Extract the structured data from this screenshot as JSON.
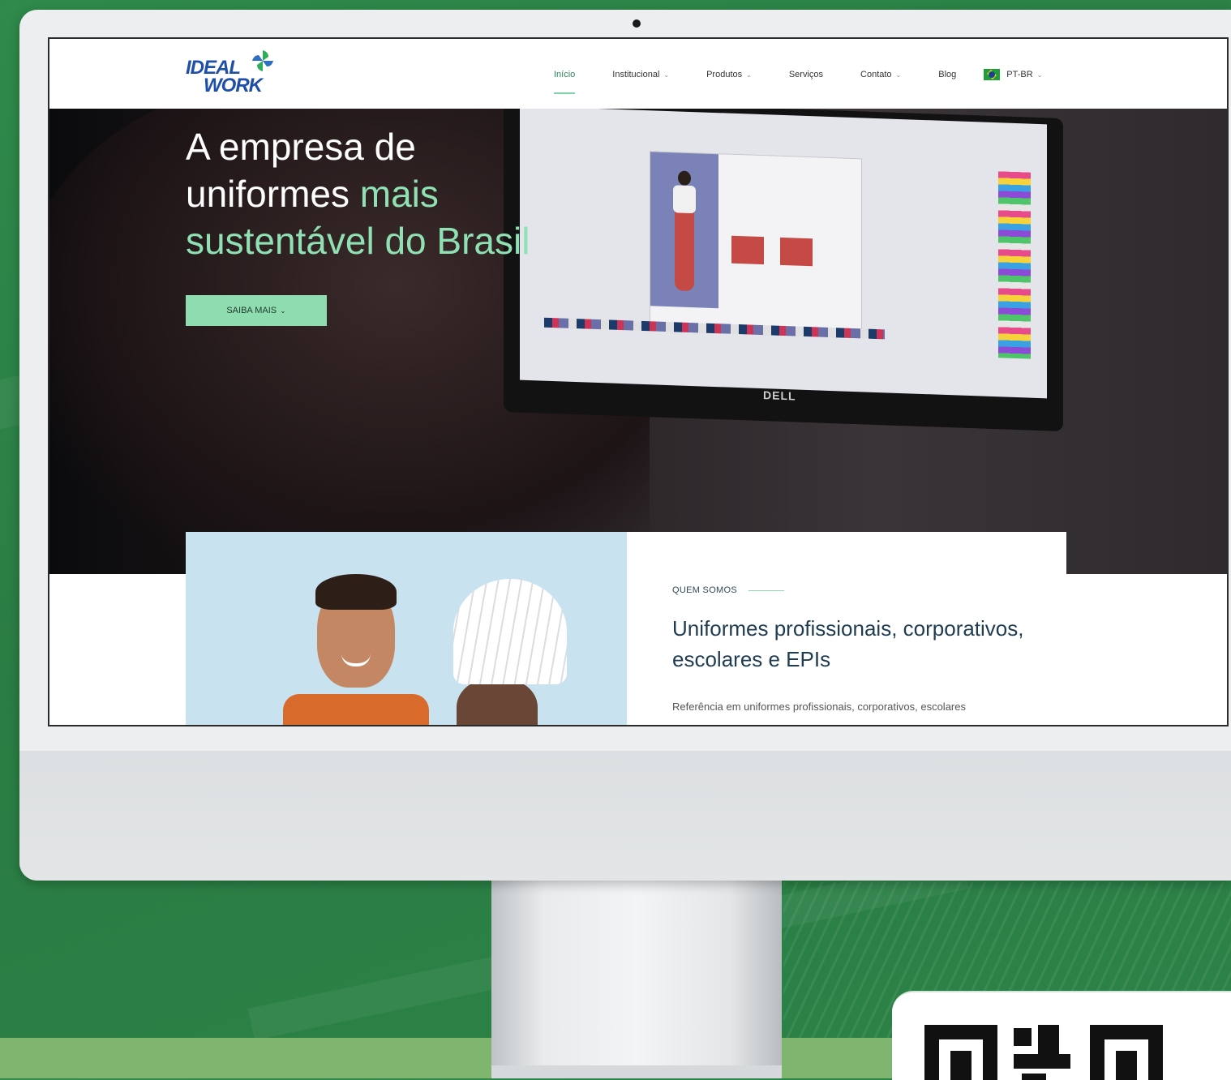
{
  "site": {
    "logo": {
      "line1": "IDEAL",
      "line2": "WORK"
    },
    "nav": [
      {
        "label": "Início",
        "dropdown": false,
        "active": true
      },
      {
        "label": "Institucional",
        "dropdown": true,
        "active": false
      },
      {
        "label": "Produtos",
        "dropdown": true,
        "active": false
      },
      {
        "label": "Serviços",
        "dropdown": false,
        "active": false
      },
      {
        "label": "Contato",
        "dropdown": true,
        "active": false
      },
      {
        "label": "Blog",
        "dropdown": false,
        "active": false
      }
    ],
    "language": {
      "label": "PT-BR",
      "flag": "brazil-flag-icon"
    }
  },
  "hero": {
    "title_line1": "A empresa de",
    "title_line2_a": "uniformes ",
    "title_line2_b": "mais",
    "title_line3": "sustentável do Brasil",
    "button_label": "SAIBA MAIS",
    "monitor_brand": "DELL"
  },
  "about": {
    "eyebrow": "QUEM SOMOS",
    "title": "Uniformes profissionais, corporativos, escolares e EPIs",
    "text": "Referência em uniformes profissionais, corporativos, escolares"
  },
  "colors": {
    "background_green": "#2a7d44",
    "accent_mint": "#8fdcb0",
    "logo_blue": "#1f4fa8",
    "heading_navy": "#1f3c50"
  }
}
